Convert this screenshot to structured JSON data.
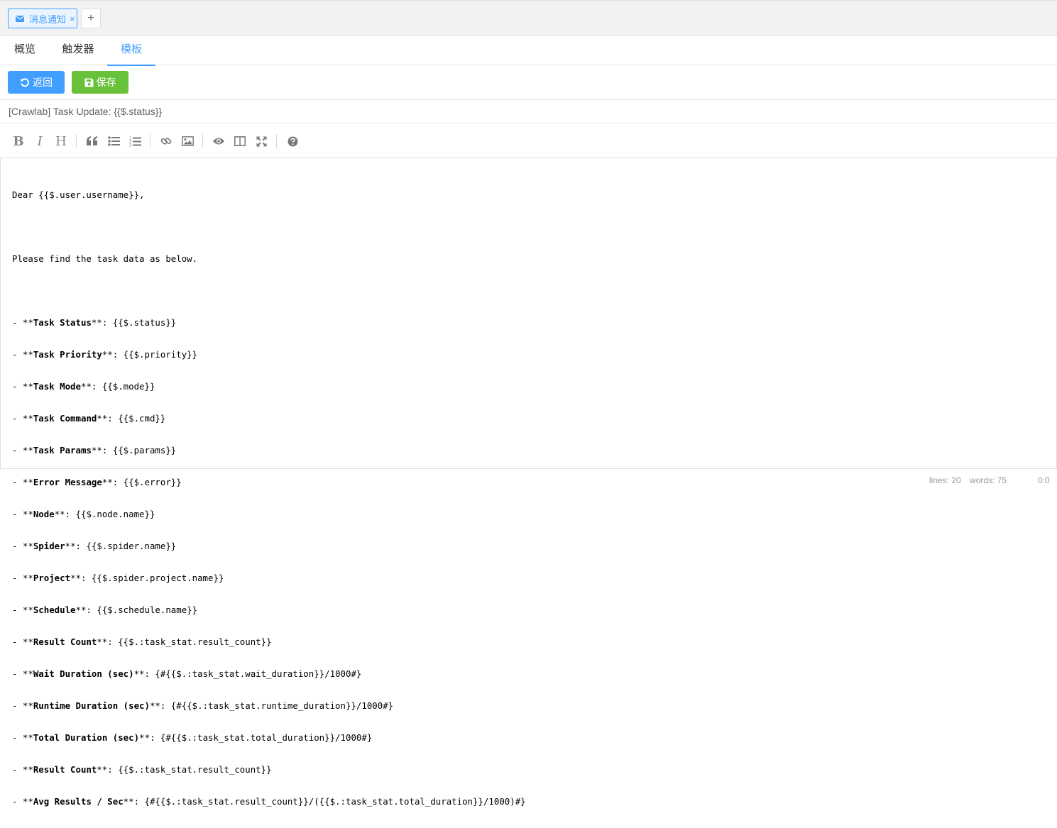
{
  "top_tab": {
    "label": "消息通知",
    "close_glyph": "×",
    "add_glyph": "+",
    "icon": "envelope-icon"
  },
  "sub_tabs": [
    {
      "label": "概览",
      "active": false
    },
    {
      "label": "触发器",
      "active": false
    },
    {
      "label": "模板",
      "active": true
    }
  ],
  "actions": {
    "back_label": "返回",
    "save_label": "保存"
  },
  "subject": {
    "value": "[Crawlab] Task Update: {{$.status}}"
  },
  "toolbar_icons": [
    "bold-icon",
    "italic-icon",
    "heading-icon",
    "quote-icon",
    "unordered-list-icon",
    "ordered-list-icon",
    "link-icon",
    "image-icon",
    "preview-icon",
    "side-by-side-icon",
    "fullscreen-icon",
    "help-icon"
  ],
  "editor": {
    "lines": [
      {
        "prefix": "Dear {{$.user.username}},",
        "label": "",
        "rest": ""
      },
      {
        "prefix": "",
        "label": "",
        "rest": ""
      },
      {
        "prefix": "Please find the task data as below.",
        "label": "",
        "rest": ""
      },
      {
        "prefix": "",
        "label": "",
        "rest": ""
      },
      {
        "prefix": "- **",
        "label": "Task Status",
        "rest": "**: {{$.status}}"
      },
      {
        "prefix": "- **",
        "label": "Task Priority",
        "rest": "**: {{$.priority}}"
      },
      {
        "prefix": "- **",
        "label": "Task Mode",
        "rest": "**: {{$.mode}}"
      },
      {
        "prefix": "- **",
        "label": "Task Command",
        "rest": "**: {{$.cmd}}"
      },
      {
        "prefix": "- **",
        "label": "Task Params",
        "rest": "**: {{$.params}}"
      },
      {
        "prefix": "- **",
        "label": "Error Message",
        "rest": "**: {{$.error}}"
      },
      {
        "prefix": "- **",
        "label": "Node",
        "rest": "**: {{$.node.name}}"
      },
      {
        "prefix": "- **",
        "label": "Spider",
        "rest": "**: {{$.spider.name}}"
      },
      {
        "prefix": "- **",
        "label": "Project",
        "rest": "**: {{$.spider.project.name}}"
      },
      {
        "prefix": "- **",
        "label": "Schedule",
        "rest": "**: {{$.schedule.name}}"
      },
      {
        "prefix": "- **",
        "label": "Result Count",
        "rest": "**: {{$.:task_stat.result_count}}"
      },
      {
        "prefix": "- **",
        "label": "Wait Duration (sec)",
        "rest": "**: {#{{$.:task_stat.wait_duration}}/1000#}"
      },
      {
        "prefix": "- **",
        "label": "Runtime Duration (sec)",
        "rest": "**: {#{{$.:task_stat.runtime_duration}}/1000#}"
      },
      {
        "prefix": "- **",
        "label": "Total Duration (sec)",
        "rest": "**: {#{{$.:task_stat.total_duration}}/1000#}"
      },
      {
        "prefix": "- **",
        "label": "Result Count",
        "rest": "**: {{$.:task_stat.result_count}}"
      },
      {
        "prefix": "- **",
        "label": "Avg Results / Sec",
        "rest": "**: {#{{$.:task_stat.result_count}}/({{$.:task_stat.total_duration}}/1000)#}"
      }
    ]
  },
  "status_bar": {
    "lines": "lines: 20",
    "words": "words: 75",
    "cursor": "0:0"
  }
}
